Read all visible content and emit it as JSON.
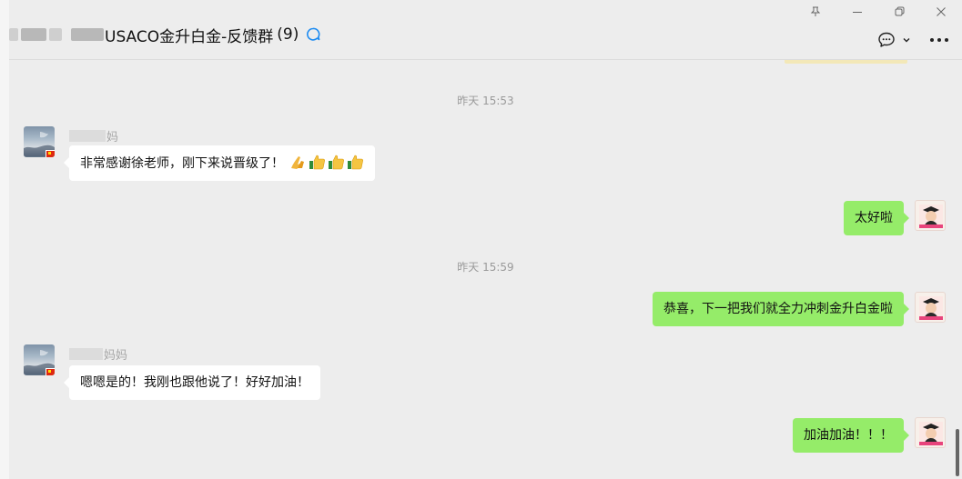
{
  "window": {
    "title": "USACO金升白金-反馈群",
    "member_count": "(9)",
    "pin_icon": "pin-icon",
    "minimize_icon": "minimize-icon",
    "restore_icon": "restore-icon",
    "close_icon": "close-icon",
    "chat_bubble_icon": "chat-bubble-icon",
    "chevron_icon": "chevron-down-icon",
    "more_icon": "more-icon"
  },
  "colors": {
    "incoming_bubble": "#ffffff",
    "outgoing_bubble": "#95ec69",
    "background": "#ededed",
    "accent": "#1d8bf1"
  },
  "messages": [
    {
      "type": "timestamp",
      "text": "昨天 15:53"
    },
    {
      "type": "incoming",
      "sender_visible": "妈",
      "text": "非常感谢徐老师，刚下来说晋级了！",
      "emojis": [
        "pray-emoji",
        "thumbs-up-emoji",
        "thumbs-up-emoji",
        "thumbs-up-emoji"
      ]
    },
    {
      "type": "outgoing",
      "text": "太好啦"
    },
    {
      "type": "timestamp",
      "text": "昨天 15:59"
    },
    {
      "type": "outgoing",
      "text": "恭喜，下一把我们就全力冲刺金升白金啦"
    },
    {
      "type": "incoming",
      "sender_visible": "妈妈",
      "text": "嗯嗯是的！我刚也跟他说了！好好加油！"
    },
    {
      "type": "outgoing",
      "text": "加油加油！！！"
    }
  ]
}
